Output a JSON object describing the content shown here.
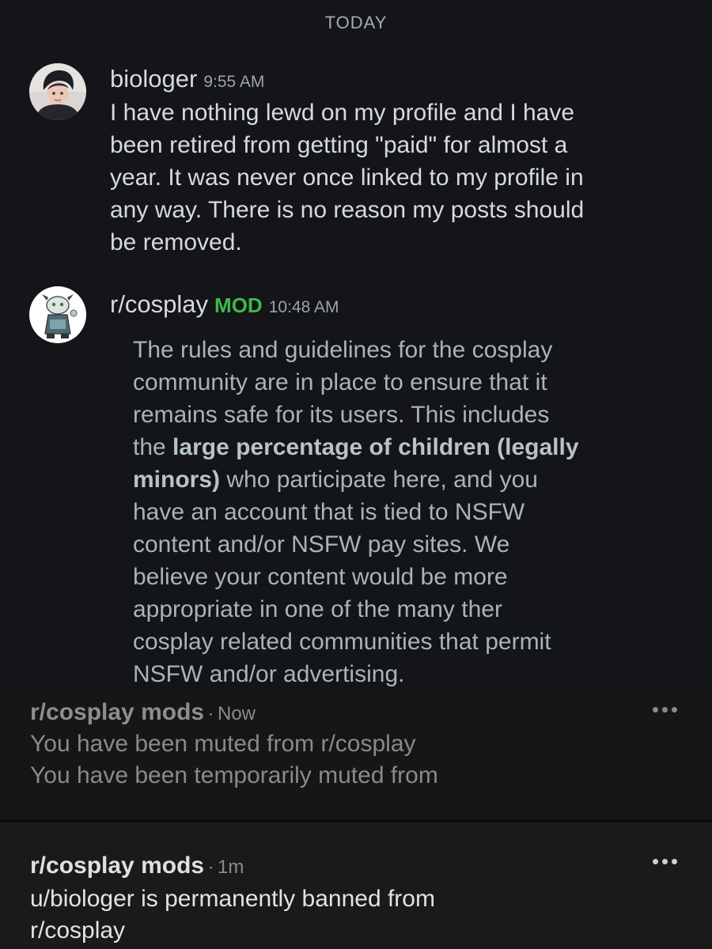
{
  "chat": {
    "date_separator": "TODAY",
    "messages": [
      {
        "username": "biologer",
        "time": "9:55 AM",
        "lines": [
          "I have nothing lewd on my profile and I have",
          "been retired from getting \"paid\" for almost a",
          "year. It was never once linked to my profile in",
          "any way. There is no reason my posts should",
          "be removed."
        ]
      },
      {
        "username": "r/cosplay",
        "badge": "MOD",
        "time": "10:48 AM",
        "body": {
          "l1": "The rules and guidelines for the cosplay",
          "l2": "community are in place to ensure that it",
          "l3": "remains safe for its users.  This includes",
          "l4_pre": "the ",
          "l4_bold": "large percentage of children (legally",
          "l5_bold": "minors)",
          "l5_post": " who participate here, and you",
          "l6": "have an account that is tied to NSFW",
          "l7": "content and/or NSFW pay sites.  We",
          "l8": "believe your content would  be more",
          "l9": "appropriate in one of the many ther",
          "l10": "cosplay related communities that permit",
          "l11": "NSFW and/or advertising."
        }
      }
    ]
  },
  "notifications": [
    {
      "sender": "r/cosplay mods",
      "separator": "·",
      "time_ago": "Now",
      "lines": [
        "You have been muted from r/cosplay",
        "You have been temporarily muted from"
      ],
      "read": true
    },
    {
      "sender": "r/cosplay mods",
      "separator": "·",
      "time_ago": "1m",
      "lines": [
        "u/biologer is permanently banned from",
        "r/cosplay"
      ],
      "read": false
    }
  ],
  "icons": {
    "avatar_1": "user-avatar-photo",
    "avatar_2": "subreddit-snoo-avatar",
    "more": "more-options-icon"
  },
  "colors": {
    "mod_badge": "#3fb94a",
    "background": "#131518"
  }
}
